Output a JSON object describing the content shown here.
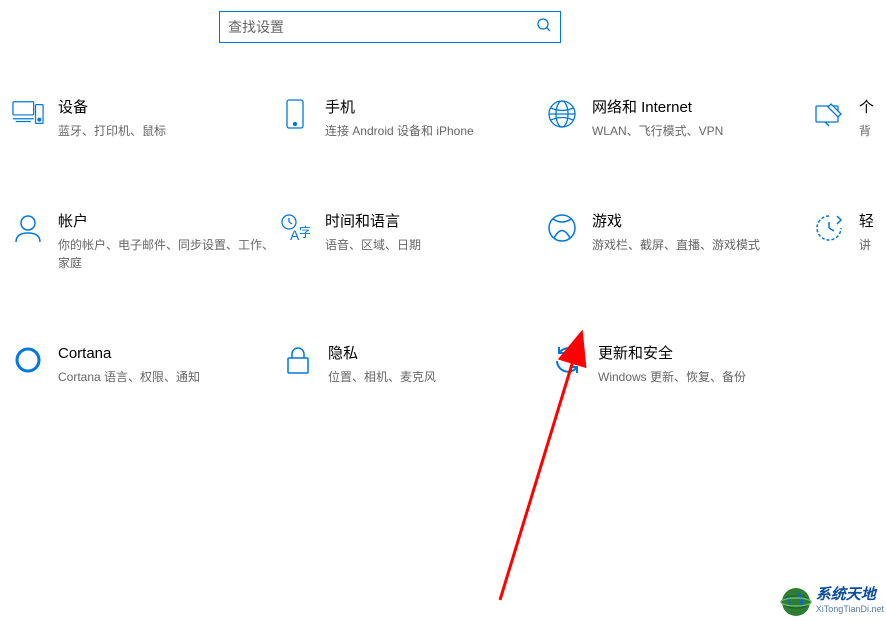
{
  "search": {
    "placeholder": "查找设置"
  },
  "tiles": {
    "devices": {
      "title": "设备",
      "desc": "蓝牙、打印机、鼠标"
    },
    "phone": {
      "title": "手机",
      "desc": "连接 Android 设备和 iPhone"
    },
    "network": {
      "title": "网络和 Internet",
      "desc": "WLAN、飞行模式、VPN"
    },
    "personal": {
      "title": "个",
      "desc": "背"
    },
    "accounts": {
      "title": "帐户",
      "desc": "你的帐户、电子邮件、同步设置、工作、家庭"
    },
    "timelang": {
      "title": "时间和语言",
      "desc": "语音、区域、日期"
    },
    "gaming": {
      "title": "游戏",
      "desc": "游戏栏、截屏、直播、游戏模式"
    },
    "ease": {
      "title": "轻",
      "desc": "讲"
    },
    "cortana": {
      "title": "Cortana",
      "desc": "Cortana 语言、权限、通知"
    },
    "privacy": {
      "title": "隐私",
      "desc": "位置、相机、麦克风"
    },
    "update": {
      "title": "更新和安全",
      "desc": "Windows 更新、恢复、备份"
    }
  },
  "watermark": {
    "cn": "系统天地",
    "en": "XiTongTianDi.net"
  }
}
